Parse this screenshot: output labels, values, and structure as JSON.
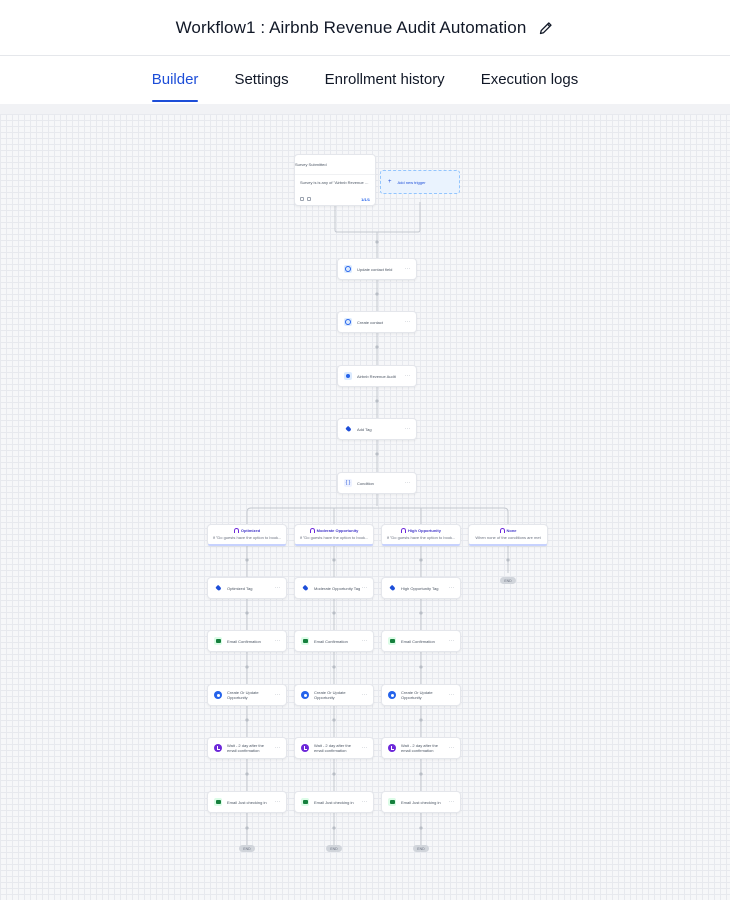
{
  "header": {
    "title": "Workflow1 : Airbnb Revenue Audit Automation",
    "edit_icon": "pencil-icon"
  },
  "tabs": [
    {
      "label": "Builder",
      "active": true
    },
    {
      "label": "Settings",
      "active": false
    },
    {
      "label": "Enrollment history",
      "active": false
    },
    {
      "label": "Execution logs",
      "active": false
    }
  ],
  "colors": {
    "accent": "#1d4ed8",
    "canvas": "#f6f7f9",
    "branch_accent": "#4338ca"
  },
  "trigger": {
    "label": "Survey Submitted",
    "filter": "Survey is is any of \"Airbnb Revenue Audit\"",
    "count": "1/1/1",
    "icon": "survey-icon"
  },
  "add_trigger": {
    "label": "Add new trigger",
    "icon": "plus-icon"
  },
  "actions": [
    {
      "label": "Update contact field",
      "icon": "user-icon"
    },
    {
      "label": "Create contact",
      "icon": "user-plus-icon"
    },
    {
      "label": "Airbnb Revenue Audit",
      "icon": "form-icon"
    },
    {
      "label": "Add Tag",
      "icon": "tag-icon"
    },
    {
      "label": "Condition",
      "icon": "condition-icon"
    }
  ],
  "branches": [
    {
      "name": "Optimized",
      "desc": "If \"Do guests have the option to book...",
      "steps": [
        {
          "label": "Optimized Tag",
          "icon": "tag-icon"
        },
        {
          "label": "Email Confirmation",
          "icon": "email-icon"
        },
        {
          "label": "Create Or Update Opportunity",
          "icon": "opportunity-icon"
        },
        {
          "label": "Wait - 2 day after the email confirmation",
          "icon": "clock-icon"
        },
        {
          "label": "Email Just checking in",
          "icon": "email-icon"
        }
      ],
      "end": "END"
    },
    {
      "name": "Moderate Opportunity",
      "desc": "If \"Do guests have the option to book...",
      "steps": [
        {
          "label": "Moderate Opportunity Tag",
          "icon": "tag-icon"
        },
        {
          "label": "Email Confirmation",
          "icon": "email-icon"
        },
        {
          "label": "Create Or Update Opportunity",
          "icon": "opportunity-icon"
        },
        {
          "label": "Wait - 2 day after the email confirmation",
          "icon": "clock-icon"
        },
        {
          "label": "Email Just checking in",
          "icon": "email-icon"
        }
      ],
      "end": "END"
    },
    {
      "name": "High Opportunity",
      "desc": "If \"Do guests have the option to book...",
      "steps": [
        {
          "label": "High Opportunity Tag",
          "icon": "tag-icon"
        },
        {
          "label": "Email Confirmation",
          "icon": "email-icon"
        },
        {
          "label": "Create Or Update Opportunity",
          "icon": "opportunity-icon"
        },
        {
          "label": "Wait - 2 day after the email confirmation",
          "icon": "clock-icon"
        },
        {
          "label": "Email Just checking in",
          "icon": "email-icon"
        }
      ],
      "end": "END"
    },
    {
      "name": "None",
      "desc": "When none of the conditions are met",
      "steps": [],
      "end": "END"
    }
  ],
  "more_label": "···"
}
